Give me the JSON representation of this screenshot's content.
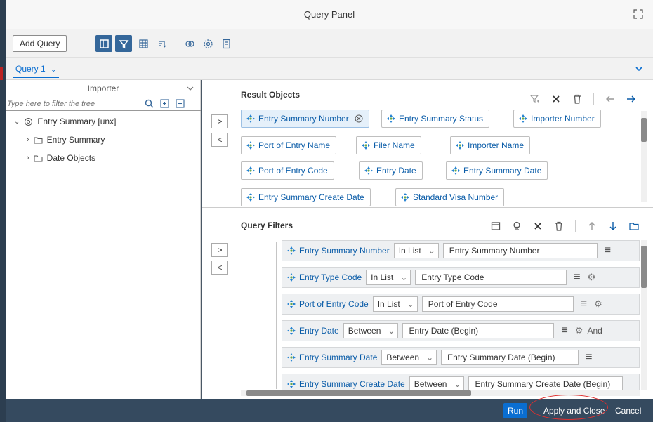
{
  "window": {
    "title": "Query Panel"
  },
  "toolbar": {
    "add_query_label": "Add Query"
  },
  "tabs": {
    "query1_label": "Query 1"
  },
  "left_panel": {
    "source_label": "Importer",
    "filter_placeholder": "Type here to filter the tree",
    "tree": {
      "root_label": "Entry Summary [unx]",
      "children": [
        {
          "label": "Entry Summary"
        },
        {
          "label": "Date Objects"
        }
      ]
    }
  },
  "result_objects": {
    "title": "Result Objects",
    "items": [
      {
        "label": "Entry Summary Number"
      },
      {
        "label": "Entry Summary Status"
      },
      {
        "label": "Importer Number"
      },
      {
        "label": "Port of Entry Name"
      },
      {
        "label": "Filer Name"
      },
      {
        "label": "Importer Name"
      },
      {
        "label": "Port of Entry Code"
      },
      {
        "label": "Entry Date"
      },
      {
        "label": "Entry Summary Date"
      },
      {
        "label": "Entry Summary Create Date"
      },
      {
        "label": "Standard Visa Number"
      }
    ]
  },
  "query_filters": {
    "title": "Query Filters",
    "rows": [
      {
        "field": "Entry Summary Number",
        "operator": "In List",
        "value": "Entry Summary Number"
      },
      {
        "field": "Entry Type Code",
        "operator": "In List",
        "value": "Entry Type Code"
      },
      {
        "field": "Port of Entry Code",
        "operator": "In List",
        "value": "Port of Entry Code"
      },
      {
        "field": "Entry Date",
        "operator": "Between",
        "value": "Entry Date (Begin)",
        "extra": "And"
      },
      {
        "field": "Entry Summary Date",
        "operator": "Between",
        "value": "Entry Summary Date (Begin)"
      },
      {
        "field": "Entry Summary Create Date",
        "operator": "Between",
        "value": "Entry Summary Create Date (Begin)"
      }
    ]
  },
  "footer": {
    "run_label": "Run",
    "apply_close_label": "Apply and Close",
    "cancel_label": "Cancel"
  },
  "colors": {
    "accent": "#0a6ed1",
    "footer_bg": "#354a5f",
    "active_icon_bg": "#35679a",
    "annotation": "#e03030"
  }
}
